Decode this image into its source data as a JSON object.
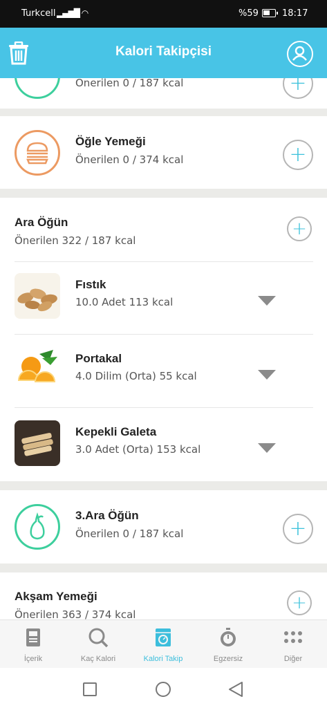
{
  "status_bar": {
    "carrier": "Turkcell",
    "battery": "%59",
    "time": "18:17"
  },
  "header": {
    "title": "Kalori Takipçisi"
  },
  "top_partial": {
    "subtitle": "Önerilen 0 / 187 kcal"
  },
  "lunch": {
    "title": "Öğle Yemeği",
    "subtitle": "Önerilen 0 / 374 kcal"
  },
  "snack": {
    "title": "Ara Öğün",
    "subtitle": "Önerilen 322 / 187 kcal",
    "items": [
      {
        "name": "Fıstık",
        "detail": "10.0 Adet 113 kcal"
      },
      {
        "name": "Portakal",
        "detail": "4.0 Dilim (Orta) 55 kcal"
      },
      {
        "name": "Kepekli Galeta",
        "detail": "3.0 Adet (Orta) 153 kcal"
      }
    ]
  },
  "snack3": {
    "title": "3.Ara Öğün",
    "subtitle": "Önerilen 0 / 187 kcal"
  },
  "dinner": {
    "title": "Akşam Yemeği",
    "subtitle": "Önerilen 363 / 374 kcal"
  },
  "nav": [
    {
      "label": "İçerik",
      "icon": "book-icon"
    },
    {
      "label": "Kaç Kalori",
      "icon": "search-icon"
    },
    {
      "label": "Kalori Takip",
      "icon": "scale-icon",
      "active": true
    },
    {
      "label": "Egzersiz",
      "icon": "stopwatch-icon"
    },
    {
      "label": "Diğer",
      "icon": "more-dots-icon"
    }
  ],
  "colors": {
    "accent": "#48c4e6",
    "lunch_icon": "#ec9a62",
    "snack_icon": "#3dcf9d"
  }
}
